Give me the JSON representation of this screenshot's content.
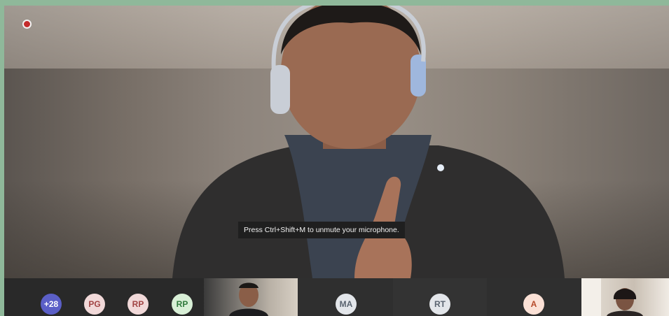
{
  "main": {
    "recording_indicator": "record-dot",
    "caption": "Press Ctrl+Shift+M to unmute your microphone."
  },
  "participants": {
    "overflow": {
      "label": "+28",
      "color": "#5b5fc7",
      "text_color": "#ffffff"
    },
    "avatars": [
      {
        "initials": "PG",
        "color": "#f1d9d9",
        "text_color": "#a14444"
      },
      {
        "initials": "RP",
        "color": "#f1d9d9",
        "text_color": "#a14444"
      },
      {
        "initials": "RP",
        "color": "#d8efd6",
        "text_color": "#2f7a3c"
      },
      {
        "initials": "MA",
        "color": "#e3e6ea",
        "text_color": "#5a6470"
      },
      {
        "initials": "RT",
        "color": "#e3e6ea",
        "text_color": "#5a6470"
      },
      {
        "initials": "A",
        "color": "#fbe1d6",
        "text_color": "#b64a2a"
      }
    ]
  }
}
